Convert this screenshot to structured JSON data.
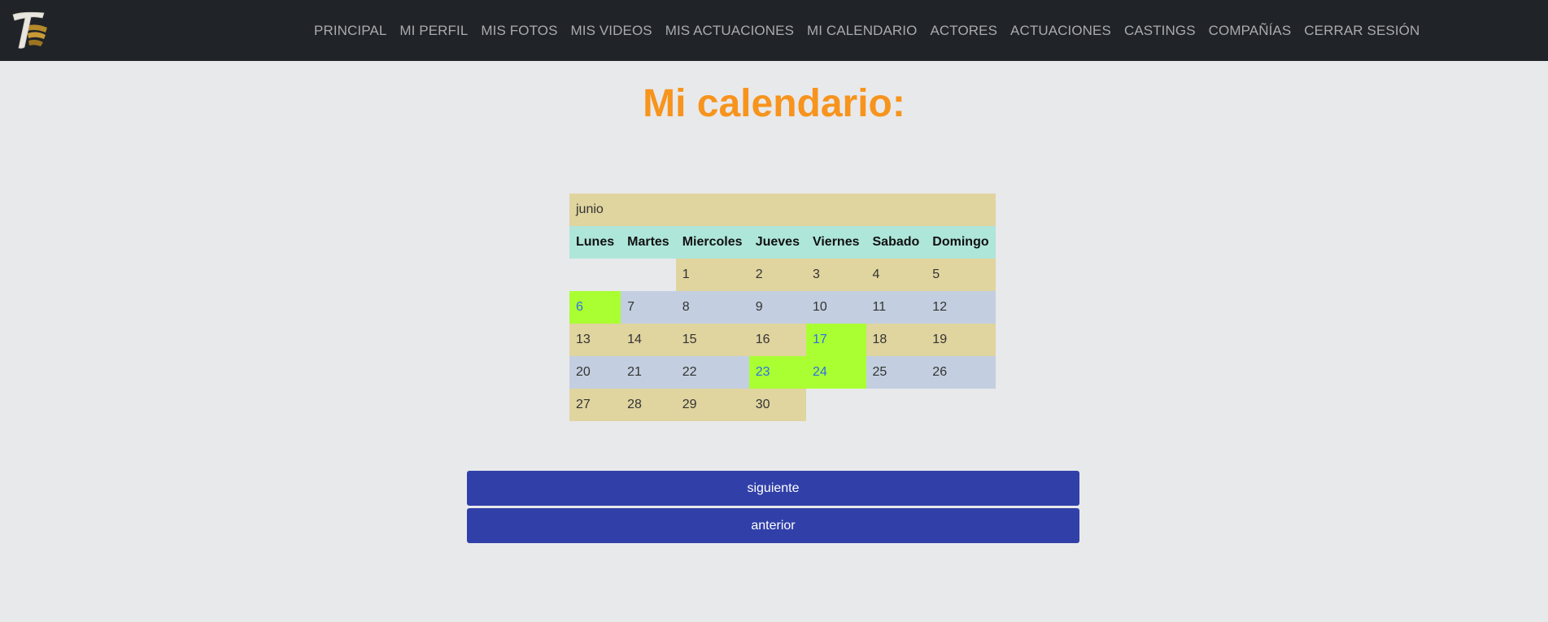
{
  "navbar": {
    "logo_icon": "theater-mask-T-logo-icon",
    "items": [
      {
        "label": "PRINCIPAL"
      },
      {
        "label": "MI PERFIL"
      },
      {
        "label": "MIS FOTOS"
      },
      {
        "label": "MIS VIDEOS"
      },
      {
        "label": "MIS ACTUACIONES"
      },
      {
        "label": "MI CALENDARIO"
      },
      {
        "label": "ACTORES"
      },
      {
        "label": "ACTUACIONES"
      },
      {
        "label": "CASTINGS"
      },
      {
        "label": "COMPAÑÍAS"
      },
      {
        "label": "CERRAR SESIÓN"
      }
    ]
  },
  "page": {
    "title": "Mi calendario:"
  },
  "calendar": {
    "month": "junio",
    "weekdays": [
      "Lunes",
      "Martes",
      "Miercoles",
      "Jueves",
      "Viernes",
      "Sabado",
      "Domingo"
    ],
    "weeks": [
      [
        "",
        "",
        "1",
        "2",
        "3",
        "4",
        "5"
      ],
      [
        "6",
        "7",
        "8",
        "9",
        "10",
        "11",
        "12"
      ],
      [
        "13",
        "14",
        "15",
        "16",
        "17",
        "18",
        "19"
      ],
      [
        "20",
        "21",
        "22",
        "23",
        "24",
        "25",
        "26"
      ],
      [
        "27",
        "28",
        "29",
        "30",
        "",
        "",
        ""
      ]
    ],
    "event_days": [
      "6",
      "17",
      "23",
      "24"
    ],
    "colors": {
      "row_a": "#e0d49f",
      "row_b": "#c3cfe0",
      "header": "#aee6da",
      "event_bg": "#aaff33",
      "event_text": "#2f6ee8"
    }
  },
  "buttons": {
    "next_label": "siguiente",
    "prev_label": "anterior",
    "color": "#3140a8"
  }
}
